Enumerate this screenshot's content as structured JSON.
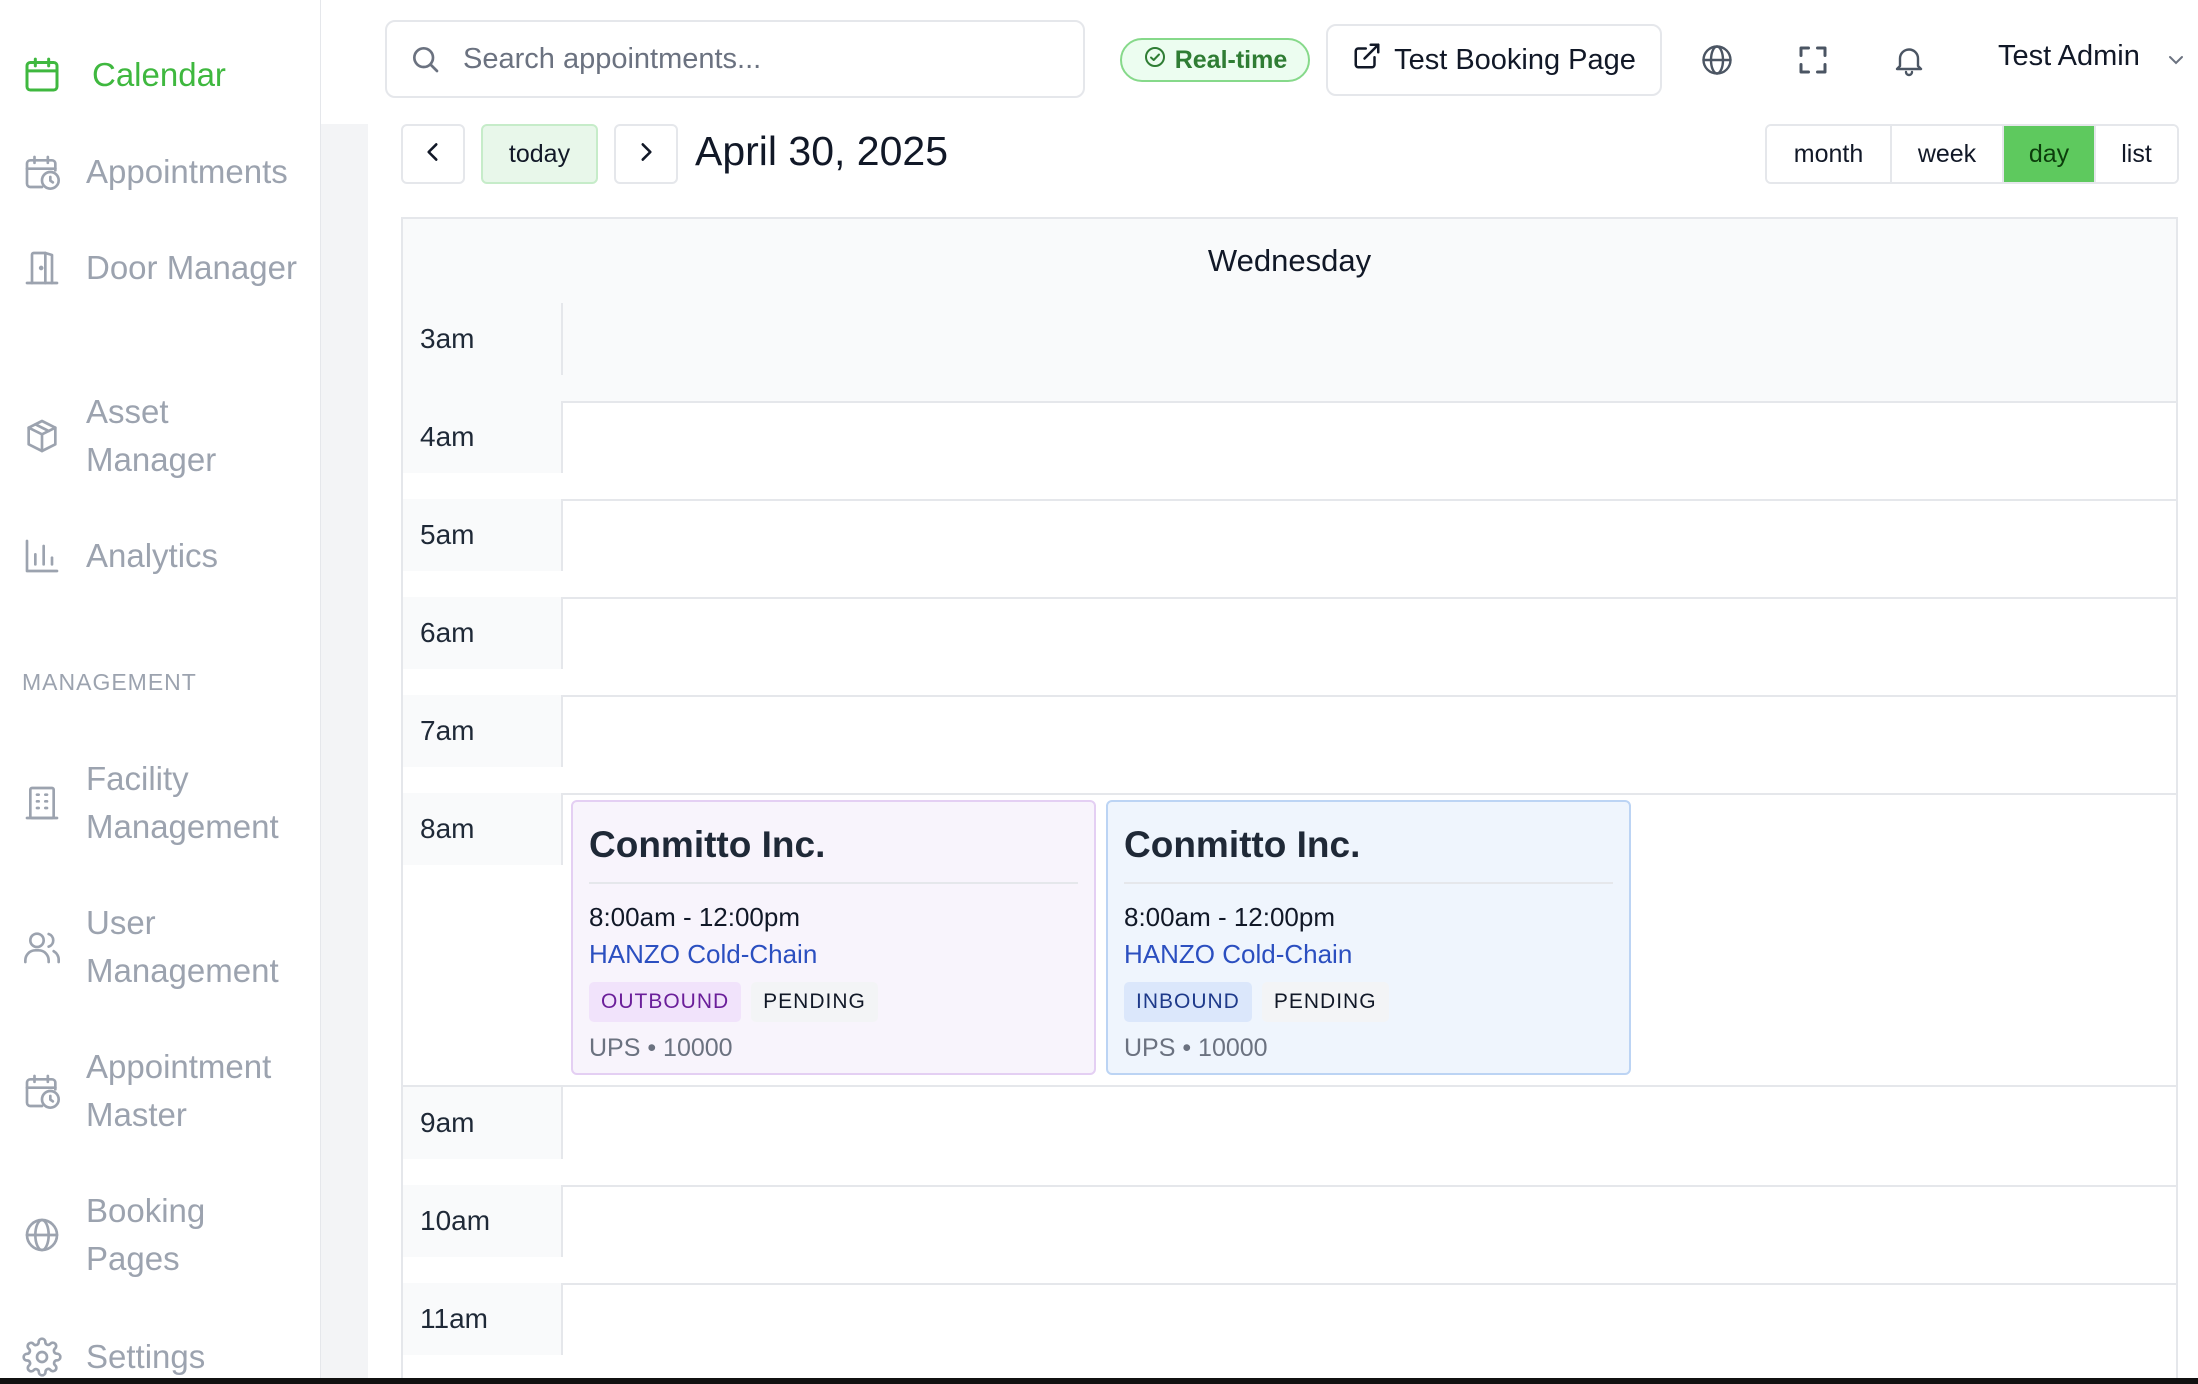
{
  "sidebar": {
    "items": [
      {
        "label": "Calendar",
        "icon": "calendar-icon",
        "active": true
      },
      {
        "label": "Appointments",
        "icon": "calendar-clock-icon"
      },
      {
        "label": "Door Manager",
        "icon": "door-icon"
      },
      {
        "label": "Asset Manager",
        "icon": "package-icon"
      },
      {
        "label": "Analytics",
        "icon": "bar-chart-icon"
      }
    ],
    "section_label": "MANAGEMENT",
    "management_items": [
      {
        "label": "Facility Management",
        "icon": "building-icon"
      },
      {
        "label": "User Management",
        "icon": "users-icon"
      },
      {
        "label": "Appointment Master",
        "icon": "calendar-clock-icon"
      },
      {
        "label": "Booking Pages",
        "icon": "globe-icon"
      },
      {
        "label": "Settings",
        "icon": "gear-icon"
      }
    ],
    "accent_color": "#3fb83f"
  },
  "header": {
    "search_placeholder": "Search appointments...",
    "realtime_label": "Real-time",
    "booking_button_label": "Test Booking Page",
    "user_name": "Test Admin"
  },
  "toolbar": {
    "today_label": "today",
    "date_title": "April 30, 2025",
    "views": [
      "month",
      "week",
      "day",
      "list"
    ],
    "active_view": "day"
  },
  "calendar": {
    "day_name": "Wednesday",
    "hours": [
      "3am",
      "4am",
      "5am",
      "6am",
      "7am",
      "8am",
      "9am",
      "10am",
      "11am"
    ],
    "events": [
      {
        "company": "Conmitto Inc.",
        "time": "8:00am - 12:00pm",
        "carrier": "HANZO Cold-Chain",
        "direction": "OUTBOUND",
        "status": "PENDING",
        "meta": "UPS • 10000"
      },
      {
        "company": "Conmitto Inc.",
        "time": "8:00am - 12:00pm",
        "carrier": "HANZO Cold-Chain",
        "direction": "INBOUND",
        "status": "PENDING",
        "meta": "UPS • 10000"
      }
    ]
  }
}
